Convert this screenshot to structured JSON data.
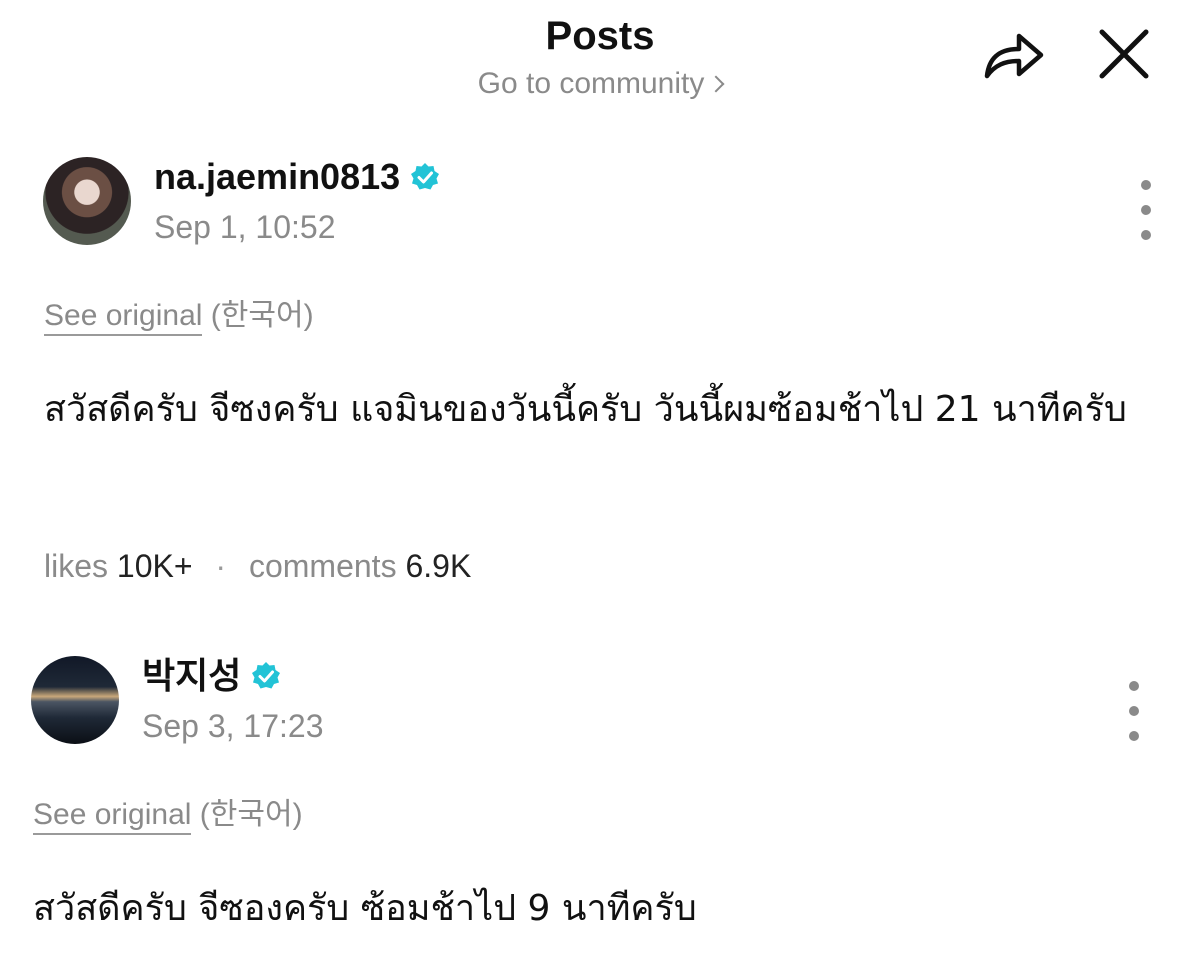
{
  "header": {
    "title": "Posts",
    "subtitle": "Go to community"
  },
  "posts": [
    {
      "username": "na.jaemin0813",
      "timestamp": "Sep 1, 10:52",
      "see_original": "See original",
      "original_lang": "(한국어)",
      "text": "สวัสดีครับ จีซงครับ แจมินของวันนี้ครับ วันนี้ผมซ้อมช้าไป 21 นาทีครับ",
      "likes_label": "likes",
      "likes_count": "10K+",
      "comments_label": "comments",
      "comments_count": "6.9K"
    },
    {
      "username": "박지성",
      "timestamp": "Sep 3, 17:23",
      "see_original": "See original",
      "original_lang": "(한국어)",
      "text": "สวัสดีครับ จีซองครับ ซ้อมช้าไป 9 นาทีครับ"
    }
  ],
  "colors": {
    "verified": "#22c3d6",
    "muted": "#8a8a8a"
  },
  "icons": {
    "share": "share-arrow-icon",
    "close": "close-icon",
    "more": "more-vertical-icon",
    "verified": "verified-badge-icon"
  }
}
